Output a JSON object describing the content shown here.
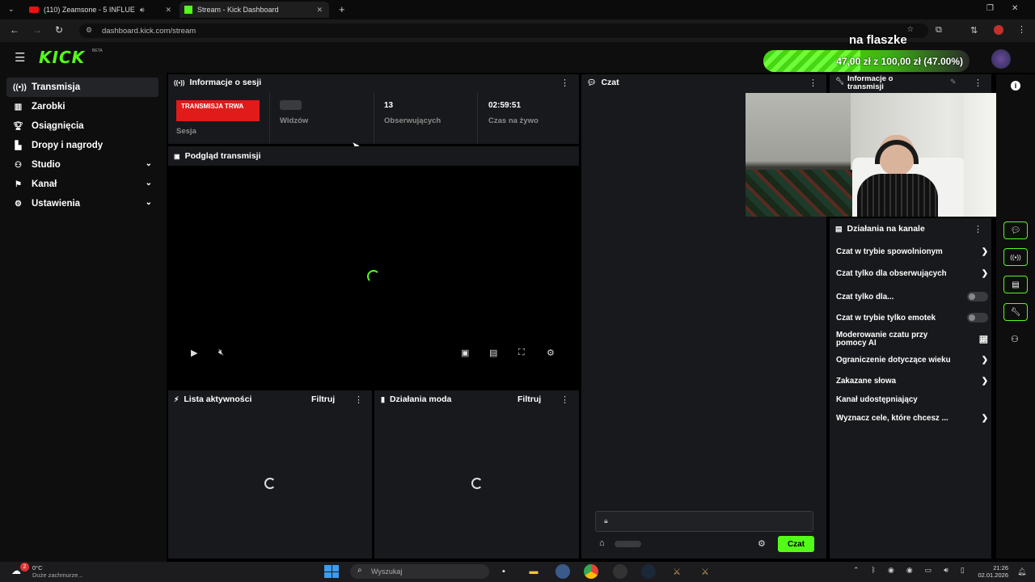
{
  "browser": {
    "tabs": [
      {
        "label": "(110) Zeamsone - 5 INFLUE",
        "icon": "youtube-icon"
      },
      {
        "label": "Stream - Kick Dashboard",
        "icon": "kick-icon"
      }
    ],
    "url": "dashboard.kick.com/stream"
  },
  "header": {
    "logo": "KICK",
    "beta": "BETA",
    "overlay_text": "na flaszke",
    "goal": {
      "text": "47,00 zł z 100,00 zł (47.00%)",
      "progress": 0.47,
      "color": "#53fc18"
    }
  },
  "sidebar": {
    "items": [
      {
        "label": "Transmisja",
        "icon": "broadcast-icon",
        "active": true
      },
      {
        "label": "Zarobki",
        "icon": "earnings-icon"
      },
      {
        "label": "Osiągnięcia",
        "icon": "trophy-icon"
      },
      {
        "label": "Dropy i nagrody",
        "icon": "gift-icon"
      },
      {
        "label": "Studio",
        "icon": "studio-icon",
        "expandable": true
      },
      {
        "label": "Kanał",
        "icon": "channel-icon",
        "expandable": true
      },
      {
        "label": "Ustawienia",
        "icon": "gear-icon",
        "expandable": true
      }
    ]
  },
  "session": {
    "title": "Informacje o sesji",
    "live_badge": "TRANSMISJA TRWA",
    "session_label": "Sesja",
    "viewers_label": "Widzów",
    "followers_value": "13",
    "followers_label": "Obserwujących",
    "uptime_value": "02:59:51",
    "uptime_label": "Czas na żywo"
  },
  "preview": {
    "title": "Podgląd transmisji"
  },
  "activity": {
    "title": "Lista aktywności",
    "filter": "Filtruj"
  },
  "modactions": {
    "title": "Działania moda",
    "filter": "Filtruj"
  },
  "chat": {
    "title": "Czat",
    "send_label": "Czat"
  },
  "stream_info": {
    "title_l1": "Informacje o",
    "title_l2": "transmisji"
  },
  "channel_actions": {
    "title": "Działania na kanale",
    "items": [
      {
        "label": "Czat w trybie spowolnionym",
        "control": "arrow"
      },
      {
        "label": "Czat tylko dla obserwujących",
        "control": "arrow"
      },
      {
        "label": "Czat tylko dla...",
        "control": "toggle"
      },
      {
        "label": "Czat w trybie tylko emotek",
        "control": "toggle"
      },
      {
        "label": "Moderowanie czatu przy pomocy AI",
        "control": "chart"
      },
      {
        "label": "Ograniczenie dotyczące wieku",
        "control": "arrow"
      },
      {
        "label": "Zakazane słowa",
        "control": "arrow"
      },
      {
        "label": "Kanał udostępniający",
        "control": "none"
      },
      {
        "label": "Wyznacz cele, które chcesz ...",
        "control": "arrow"
      }
    ]
  },
  "taskbar": {
    "weather_temp": "0°C",
    "weather_desc": "Duże zachmurze...",
    "weather_badge": "2",
    "search_placeholder": "Wyszukaj",
    "time": "21:26",
    "date": "02.01.2026"
  }
}
